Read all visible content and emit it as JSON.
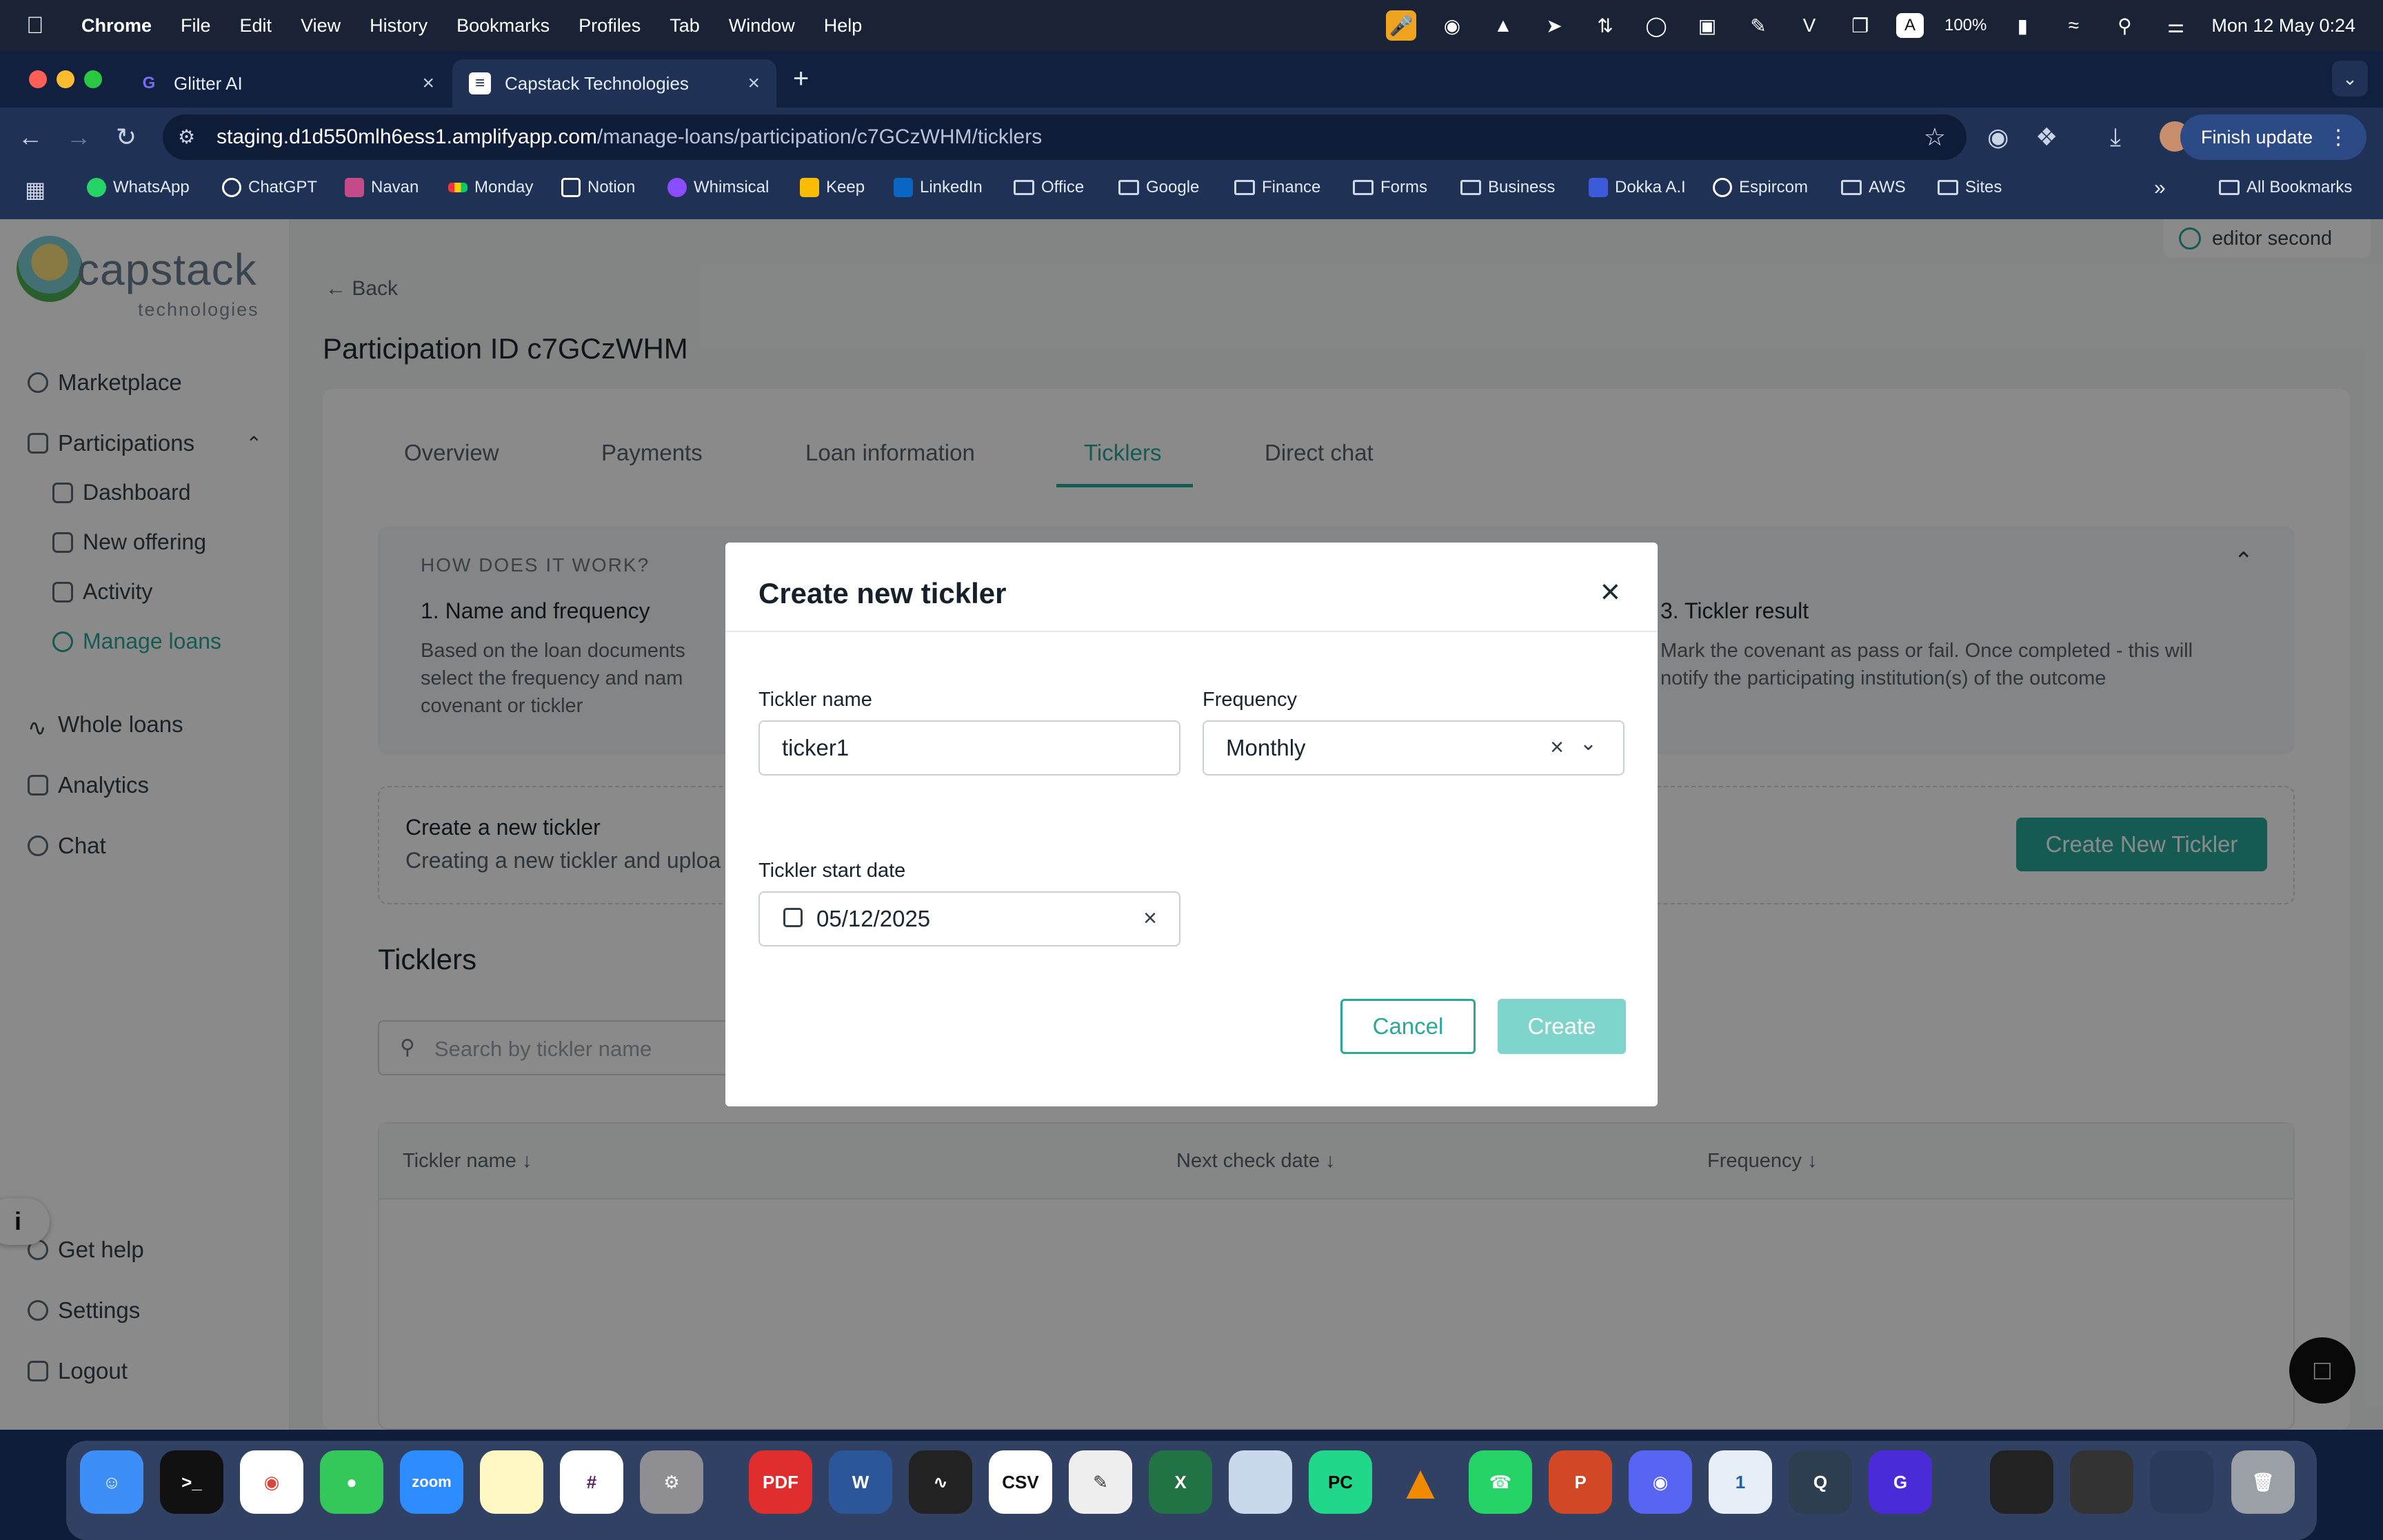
{
  "menubar": {
    "app": "Chrome",
    "items": [
      "File",
      "Edit",
      "View",
      "History",
      "Bookmarks",
      "Profiles",
      "Tab",
      "Window",
      "Help"
    ],
    "battery": "100%",
    "datetime": "Mon 12 May  0:24"
  },
  "tabs": [
    {
      "title": "Glitter AI"
    },
    {
      "title": "Capstack Technologies"
    }
  ],
  "address": {
    "host": "staging.d1d550mlh6ess1.amplifyapp.com",
    "path": "/manage-loans/participation/c7GCzWHM/ticklers"
  },
  "finish_update": "Finish update",
  "bookmarks": [
    "WhatsApp",
    "ChatGPT",
    "Navan",
    "Monday",
    "Notion",
    "Whimsical",
    "Keep",
    "LinkedIn",
    "Office",
    "Google",
    "Finance",
    "Forms",
    "Business",
    "Dokka A.I",
    "Espircom",
    "AWS",
    "Sites"
  ],
  "all_bookmarks": "All Bookmarks",
  "header": {
    "user": "editor second"
  },
  "brand": {
    "name": "capstack",
    "sub": "technologies"
  },
  "sidebar": {
    "marketplace": "Marketplace",
    "participations": "Participations",
    "dashboard": "Dashboard",
    "new_offering": "New offering",
    "activity": "Activity",
    "manage_loans": "Manage loans",
    "whole_loans": "Whole loans",
    "analytics": "Analytics",
    "chat": "Chat",
    "get_help": "Get help",
    "settings": "Settings",
    "logout": "Logout"
  },
  "page": {
    "back": "Back",
    "title": "Participation ID c7GCzWHM",
    "tabs": [
      "Overview",
      "Payments",
      "Loan information",
      "Ticklers",
      "Direct chat"
    ],
    "how": {
      "heading": "HOW DOES IT WORK?",
      "step1_title": "1. Name and frequency",
      "step1_text": "Based on the loan documents select the frequency and nam covenant or tickler",
      "step3_title": "3. Tickler result",
      "step3_text": "Mark the covenant as pass or fail. Once completed - this will notify the participating institution(s) of the outcome"
    },
    "create_box": {
      "title": "Create a new tickler",
      "text": "Creating a new tickler and uploa",
      "button": "Create New Tickler"
    },
    "ticklers_heading": "Ticklers",
    "search_placeholder": "Search by tickler name",
    "table_headers": [
      "Tickler name ↓",
      "Next check date ↓",
      "Frequency ↓"
    ]
  },
  "modal": {
    "title": "Create new tickler",
    "name_label": "Tickler name",
    "name_value": "ticker1",
    "frequency_label": "Frequency",
    "frequency_value": "Monthly",
    "start_label": "Tickler start date",
    "start_value": "05/12/2025",
    "cancel": "Cancel",
    "create": "Create"
  },
  "colors": {
    "accent": "#2aa89a",
    "accent_light": "#7fd4cc"
  }
}
